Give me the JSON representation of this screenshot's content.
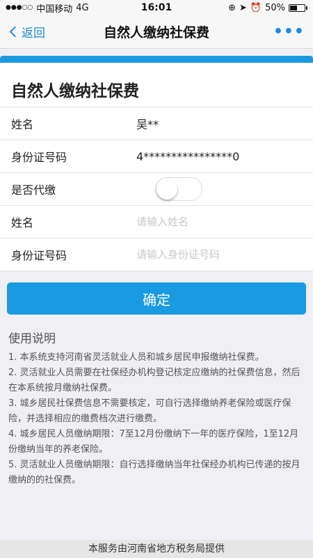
{
  "status_bar": {
    "carrier": "中国移动",
    "network": "4G",
    "time": "16:01",
    "battery": "50%"
  },
  "nav": {
    "back_label": "返回",
    "title": "自然人缴纳社保费",
    "more_label": "•••"
  },
  "form": {
    "title": "自然人缴纳社保费",
    "name_label": "姓名",
    "name_value": "吴**",
    "id_label": "身份证号码",
    "id_value": "4****************0",
    "proxy_label": "是否代缴",
    "proxy_on": false,
    "agent_name_label": "姓名",
    "agent_name_placeholder": "请输入姓名",
    "agent_id_label": "身份证号码",
    "agent_id_placeholder": "请输入身份证号码"
  },
  "confirm_label": "确定",
  "instructions": {
    "title": "使用说明",
    "items": [
      "1. 本系统支持河南省灵活就业人员和城乡居民申报缴纳社保费。",
      "2. 灵活就业人员需要在社保经办机构登记核定应缴纳的社保费信息，然后在本系统按月缴纳社保费。",
      "3. 城乡居民社保费信息不需要核定，可自行选择缴纳养老保险或医疗保险，并选择相应的缴费档次进行缴费。",
      "4. 城乡居民人员缴纳期限：7至12月份缴纳下一年的医疗保险，1至12月份缴纳当年的养老保险。",
      "5. 灵活就业人员缴纳期限：自行选择缴纳当年社保经办机构已传递的按月缴纳的的社保费。"
    ]
  },
  "footer": "本服务由河南省地方税务局提供",
  "colors": {
    "accent": "#1a9ae0",
    "link": "#1a8be0"
  }
}
